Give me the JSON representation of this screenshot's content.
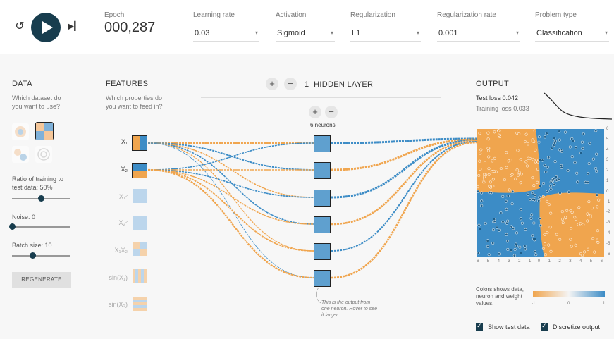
{
  "toolbar": {
    "epoch_label": "Epoch",
    "epoch_value": "000,287",
    "learning_rate": {
      "label": "Learning rate",
      "value": "0.03"
    },
    "activation": {
      "label": "Activation",
      "value": "Sigmoid"
    },
    "regularization": {
      "label": "Regularization",
      "value": "L1"
    },
    "regularization_rate": {
      "label": "Regularization rate",
      "value": "0.001"
    },
    "problem_type": {
      "label": "Problem type",
      "value": "Classification"
    }
  },
  "data_panel": {
    "title": "DATA",
    "subtitle": "Which dataset do you want to use?",
    "ratio_label": "Ratio of training to test data:  50%",
    "ratio_value": 0.5,
    "noise_label": "Noise:  0",
    "noise_value": 0,
    "batch_label": "Batch size:  10",
    "batch_value": 0.35,
    "regenerate_label": "REGENERATE"
  },
  "features_panel": {
    "title": "FEATURES",
    "subtitle": "Which properties do you want to feed in?",
    "features": [
      {
        "label": "X₁",
        "active": true
      },
      {
        "label": "X₂",
        "active": true
      },
      {
        "label": "X₁²",
        "active": false
      },
      {
        "label": "X₂²",
        "active": false
      },
      {
        "label": "X₁X₂",
        "active": false
      },
      {
        "label": "sin(X₁)",
        "active": false
      },
      {
        "label": "sin(X₂)",
        "active": false
      }
    ]
  },
  "network": {
    "layer_count": "1",
    "layer_label": "HIDDEN LAYER",
    "neuron_label": "6 neurons",
    "note": "This is the output from one neuron. Hover to see it larger."
  },
  "output_panel": {
    "title": "OUTPUT",
    "test_loss_label": "Test loss",
    "test_loss_value": "0.042",
    "training_loss_label": "Training loss",
    "training_loss_value": "0.033",
    "x_ticks": [
      "-6",
      "-5",
      "-4",
      "-3",
      "-2",
      "-1",
      "0",
      "1",
      "2",
      "3",
      "4",
      "5",
      "6"
    ],
    "y_ticks": [
      "6",
      "5",
      "4",
      "3",
      "2",
      "1",
      "0",
      "-1",
      "-2",
      "-3",
      "-4",
      "-5",
      "-6"
    ],
    "legend_text": "Colors shows data, neuron and weight values.",
    "legend_ticks": [
      "-1",
      "0",
      "1"
    ],
    "show_test_label": "Show test data",
    "discretize_label": "Discretize output"
  },
  "colors": {
    "orange": "#f0a54e",
    "blue": "#3c8cc6",
    "dark": "#183d4e"
  }
}
